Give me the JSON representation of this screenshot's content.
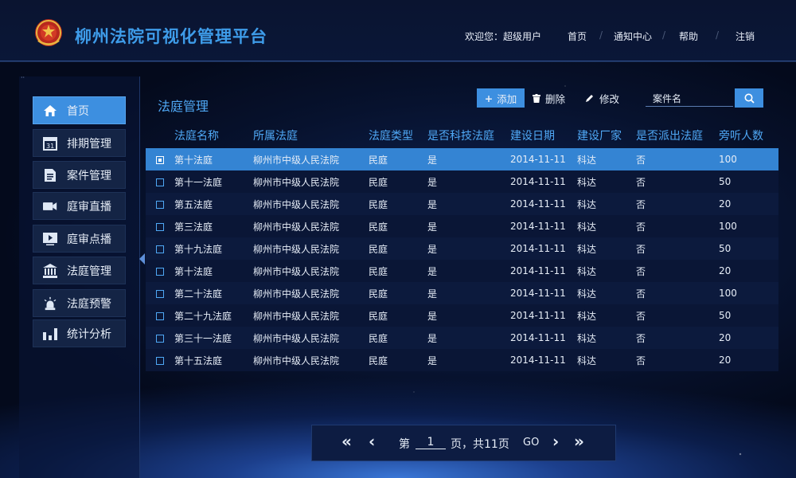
{
  "header": {
    "title": "柳州法院可视化管理平台",
    "welcome": "欢迎您：超级用户",
    "links": [
      "首页",
      "通知中心",
      "帮助",
      "注销"
    ]
  },
  "sidebar": {
    "items": [
      {
        "label": "首页",
        "icon": "home-icon",
        "active": true
      },
      {
        "label": "排期管理",
        "icon": "calendar-icon",
        "active": false
      },
      {
        "label": "案件管理",
        "icon": "document-icon",
        "active": false
      },
      {
        "label": "庭审直播",
        "icon": "video-camera-icon",
        "active": false
      },
      {
        "label": "庭审点播",
        "icon": "play-video-icon",
        "active": false
      },
      {
        "label": "法庭管理",
        "icon": "courthouse-icon",
        "active": false
      },
      {
        "label": "法庭预警",
        "icon": "alarm-light-icon",
        "active": false
      },
      {
        "label": "统计分析",
        "icon": "bar-chart-icon",
        "active": false
      }
    ]
  },
  "main": {
    "title": "法庭管理",
    "toolbar": {
      "add": "添加",
      "delete": "删除",
      "edit": "修改",
      "search_value": "案件名"
    },
    "columns": [
      "法庭名称",
      "所属法庭",
      "法庭类型",
      "是否科技法庭",
      "建设日期",
      "建设厂家",
      "是否派出法庭",
      "旁听人数"
    ],
    "rows": [
      [
        "第十法庭",
        "柳州市中级人民法院",
        "民庭",
        "是",
        "2014-11-11",
        "科达",
        "否",
        "100"
      ],
      [
        "第十一法庭",
        "柳州市中级人民法院",
        "民庭",
        "是",
        "2014-11-11",
        "科达",
        "否",
        "50"
      ],
      [
        "第五法庭",
        "柳州市中级人民法院",
        "民庭",
        "是",
        "2014-11-11",
        "科达",
        "否",
        "20"
      ],
      [
        "第三法庭",
        "柳州市中级人民法院",
        "民庭",
        "是",
        "2014-11-11",
        "科达",
        "否",
        "100"
      ],
      [
        "第十九法庭",
        "柳州市中级人民法院",
        "民庭",
        "是",
        "2014-11-11",
        "科达",
        "否",
        "50"
      ],
      [
        "第十法庭",
        "柳州市中级人民法院",
        "民庭",
        "是",
        "2014-11-11",
        "科达",
        "否",
        "20"
      ],
      [
        "第二十法庭",
        "柳州市中级人民法院",
        "民庭",
        "是",
        "2014-11-11",
        "科达",
        "否",
        "100"
      ],
      [
        "第二十九法庭",
        "柳州市中级人民法院",
        "民庭",
        "是",
        "2014-11-11",
        "科达",
        "否",
        "50"
      ],
      [
        "第三十一法庭",
        "柳州市中级人民法院",
        "民庭",
        "是",
        "2014-11-11",
        "科达",
        "否",
        "20"
      ],
      [
        "第十五法庭",
        "柳州市中级人民法院",
        "民庭",
        "是",
        "2014-11-11",
        "科达",
        "否",
        "20"
      ]
    ],
    "selected_row": 0
  },
  "pager": {
    "first": "«",
    "prev": "‹",
    "page_prefix": "第",
    "page_value": "1",
    "page_suffix": "页，共11页",
    "go": "GO",
    "next": "›",
    "last": "»"
  },
  "colors": {
    "accent": "#3d8fe0",
    "title": "#3e9ce9",
    "header_text": "#4fa8f5"
  }
}
